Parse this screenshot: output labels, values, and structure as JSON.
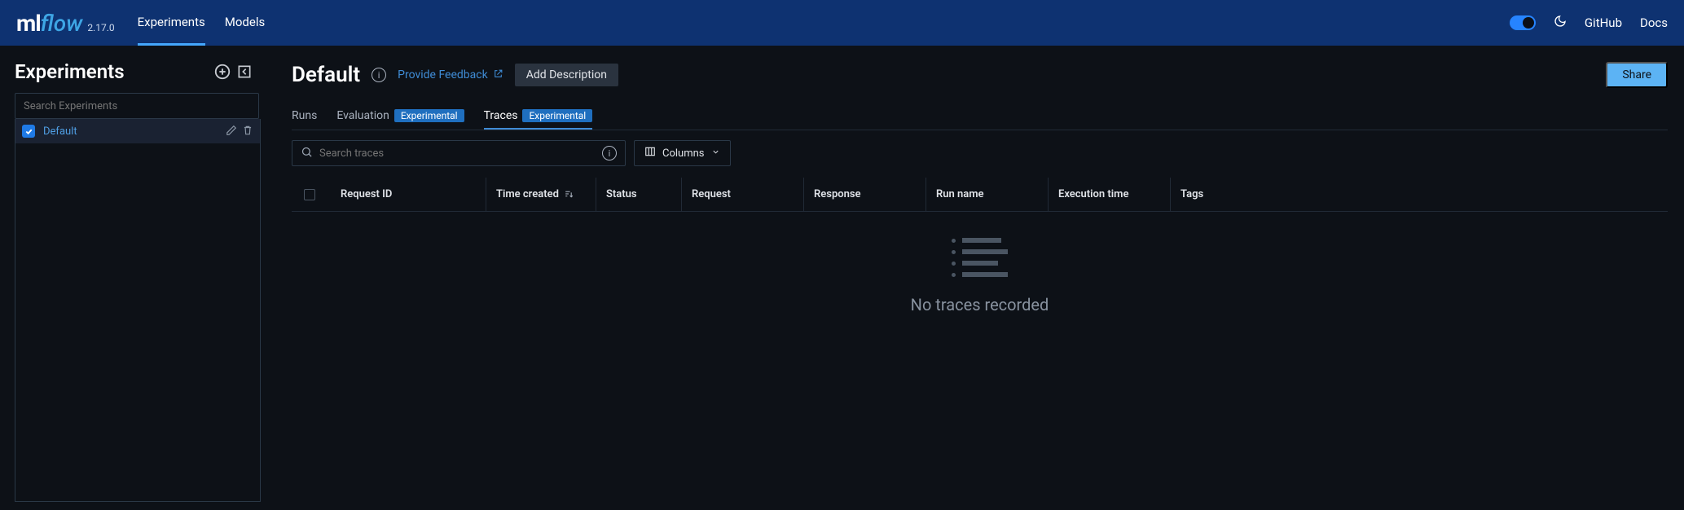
{
  "brand": {
    "ml": "ml",
    "flow": "flow",
    "version": "2.17.0"
  },
  "nav": {
    "experiments": "Experiments",
    "models": "Models",
    "github": "GitHub",
    "docs": "Docs"
  },
  "sidebar": {
    "title": "Experiments",
    "search_placeholder": "Search Experiments",
    "items": [
      {
        "name": "Default"
      }
    ]
  },
  "page": {
    "title": "Default",
    "feedback": "Provide Feedback",
    "add_description": "Add Description",
    "share": "Share"
  },
  "tabs": {
    "runs": "Runs",
    "evaluation": "Evaluation",
    "traces": "Traces",
    "badge": "Experimental"
  },
  "toolbar": {
    "search_placeholder": "Search traces",
    "columns": "Columns"
  },
  "columns": {
    "request_id": "Request ID",
    "time_created": "Time created",
    "status": "Status",
    "request": "Request",
    "response": "Response",
    "run_name": "Run name",
    "execution_time": "Execution time",
    "tags": "Tags"
  },
  "empty": "No traces recorded"
}
